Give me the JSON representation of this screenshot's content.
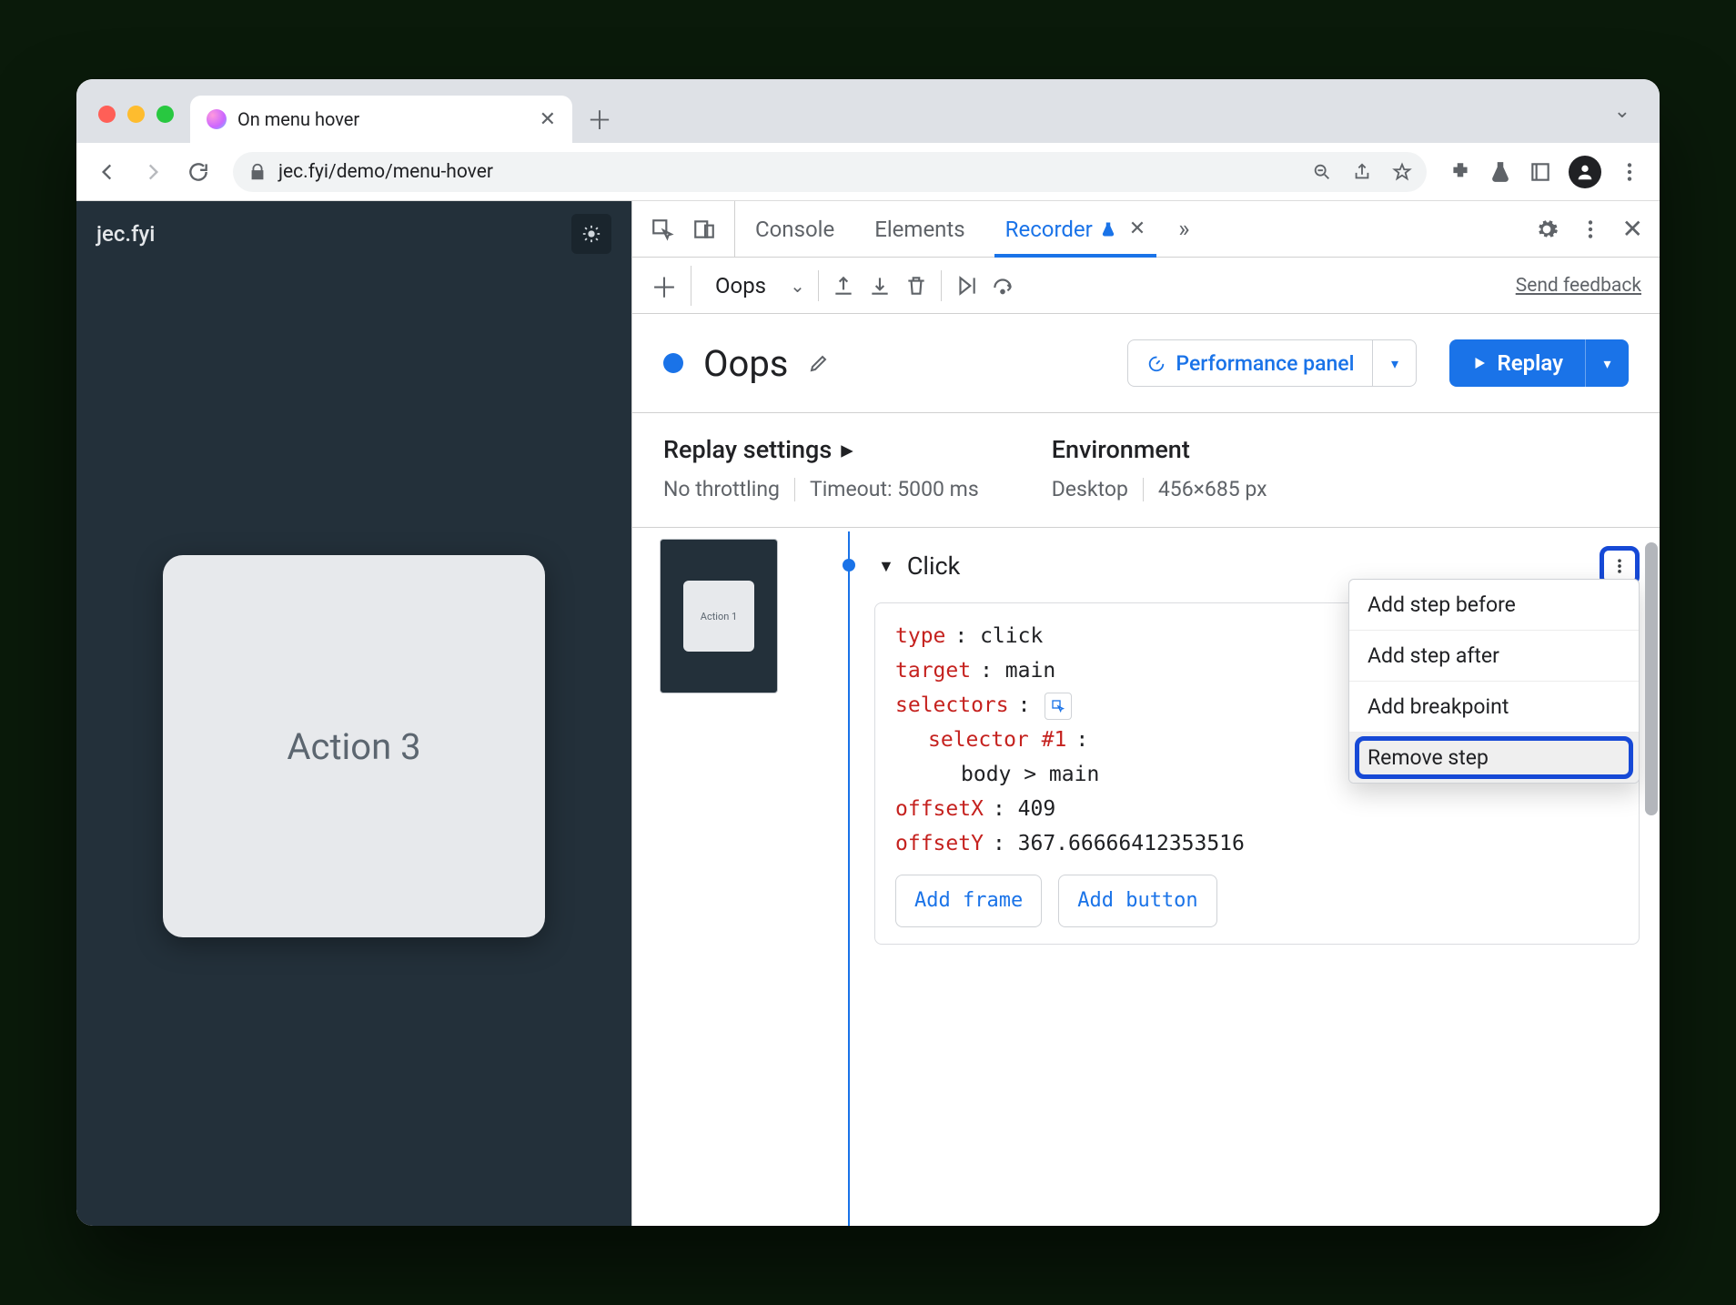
{
  "browser": {
    "tab_title": "On menu hover",
    "url": "jec.fyi/demo/menu-hover"
  },
  "page": {
    "brand": "jec.fyi",
    "card_label": "Action 3"
  },
  "devtools": {
    "tabs": {
      "console": "Console",
      "elements": "Elements",
      "recorder": "Recorder"
    },
    "recording_name_toolbar": "Oops",
    "feedback": "Send feedback",
    "header": {
      "title": "Oops",
      "perf_label": "Performance panel",
      "replay_label": "Replay"
    },
    "settings": {
      "replay_title": "Replay settings",
      "throttling": "No throttling",
      "timeout": "Timeout: 5000 ms",
      "env_title": "Environment",
      "env_device": "Desktop",
      "env_size": "456×685 px"
    },
    "thumb_label": "Action 1",
    "step": {
      "title": "Click",
      "rows": {
        "type_k": "type",
        "type_v": ": click",
        "target_k": "target",
        "target_v": ": main",
        "selectors_k": "selectors",
        "selectors_v": ":",
        "selector1_k": "selector #1",
        "selector1_v": ":",
        "selector1_body": "body > main",
        "offsetx_k": "offsetX",
        "offsetx_v": ": 409",
        "offsety_k": "offsetY",
        "offsety_v": ": 367.66666412353516"
      },
      "add_frame": "Add frame",
      "add_button": "Add button"
    },
    "menu": {
      "before": "Add step before",
      "after": "Add step after",
      "breakpoint": "Add breakpoint",
      "remove": "Remove step"
    }
  }
}
